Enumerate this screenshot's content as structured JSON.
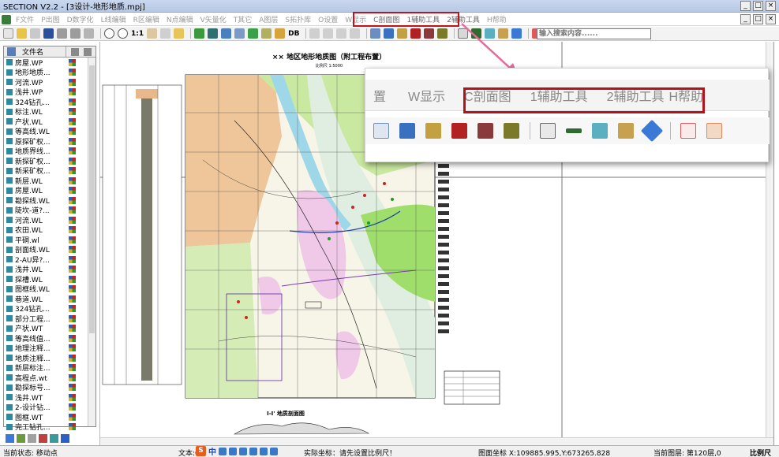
{
  "window": {
    "title": "SECTION V2.2 - [3设计-地形地质.mpj]",
    "controls": [
      "_",
      "□",
      "×"
    ],
    "menu_controls": [
      "_",
      "□",
      "×"
    ]
  },
  "menubar": {
    "items": [
      "F文件",
      "P出图",
      "D数字化",
      "L线编辑",
      "R区编辑",
      "N点编辑",
      "V矢量化",
      "T其它",
      "A图层",
      "S拓扑库",
      "O设置",
      "W显示",
      "C剖面图",
      "1辅助工具",
      "2辅助工具",
      "H帮助"
    ]
  },
  "toolbar": {
    "zoom_ratio": "1:1",
    "db_label": "DB",
    "text_p": "P",
    "text_a": "A+",
    "search_placeholder": "输入搜索内容......"
  },
  "sidebar": {
    "header_label": "文件名",
    "files": [
      "房屋.WP",
      "地形地质...",
      "河流.WP",
      "浅井.WP",
      "324钻孔...",
      "标注.WL",
      "产状.WL",
      "等高线.WL",
      "原探矿权...",
      "地质界线...",
      "新探矿权...",
      "新采矿权...",
      "新层.WL",
      "房屋.WL",
      "勘探线.WL",
      "陡坎-道?...",
      "河流.WL",
      "农田.WL",
      "平硐.wl",
      "剖面线.WL",
      "2-AU异?...",
      "浅井.WL",
      "探槽.WL",
      "图框线.WL",
      "巷道.WL",
      "324钻孔...",
      "部分工程...",
      "产状.WT",
      "等高线值...",
      "地理注释...",
      "地质注释...",
      "新层标注...",
      "高程点.wt",
      "勘探标号...",
      "浅井.WT",
      "2-设计钻...",
      "图框.WT",
      "完工钻孔..."
    ]
  },
  "map": {
    "title": "×× 地区地形地质图（附工程布置）",
    "subtitle": "比例尺 1:5000",
    "section_title": "Ⅰ-Ⅰ' 地质剖面图"
  },
  "zoom": {
    "menu_items": [
      "置",
      "W显示",
      "C剖面图",
      "1辅助工具",
      "2辅助工具",
      "H帮助"
    ]
  },
  "status": {
    "mode": "当前状态: 移动点",
    "text_label": "文本:0",
    "ime_label": "中",
    "actual_coord": "实际坐标：请先设置比例尺！",
    "map_coord": "图面坐标 X:109885.995,Y:673265.828",
    "layer": "当前图层: 第120层,0",
    "scale_button": "比例尺"
  },
  "colors": {
    "highlight": "#c0141c",
    "arrow": "#e8699a",
    "titlebar": "#c9d8ee"
  }
}
